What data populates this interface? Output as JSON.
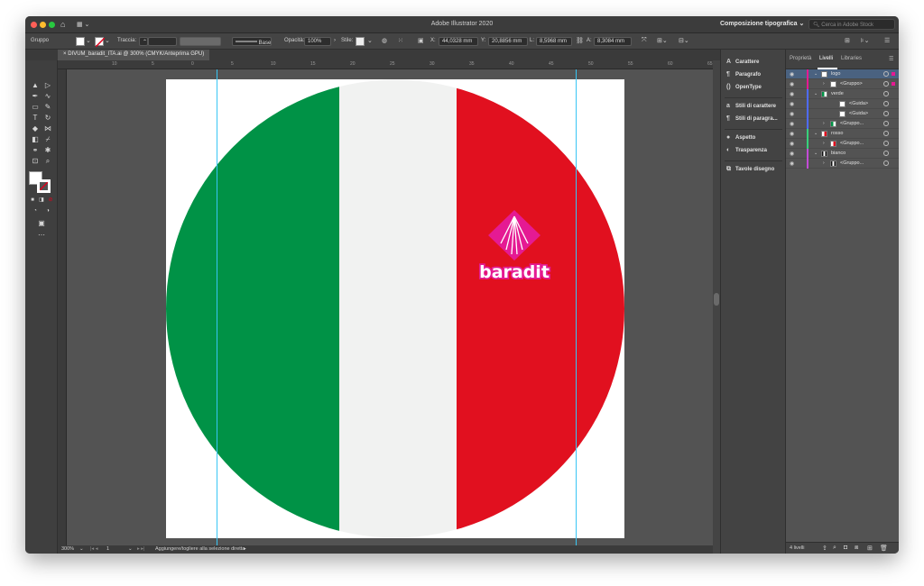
{
  "app": {
    "title": "Adobe Illustrator 2020",
    "workspace": "Composizione tipografica",
    "stock_search_placeholder": "Cerca in Adobe Stock"
  },
  "control_bar": {
    "selection_label": "Gruppo",
    "stroke_label": "Traccia:",
    "stroke_profile": "Base",
    "opacity_label": "Opacità:",
    "opacity_value": "100%",
    "style_label": "Stile:",
    "x_label": "X:",
    "x_value": "44,0328 mm",
    "y_label": "Y:",
    "y_value": "20,8856 mm",
    "w_label": "L:",
    "w_value": "8,5968 mm",
    "h_label": "A:",
    "h_value": "8,3084 mm"
  },
  "document_tab": {
    "title": "DIVUM_baradit_ITA.ai @ 300% (CMYK/Anteprima GPU)",
    "close": "×"
  },
  "rulers": {
    "top_ticks": [
      "10",
      "5",
      "0",
      "5",
      "10",
      "15",
      "20",
      "25",
      "30",
      "35",
      "40",
      "45",
      "50",
      "55",
      "60",
      "65"
    ]
  },
  "artwork": {
    "flag_colors": {
      "green": "#009246",
      "white": "#f1f2f1",
      "red": "#e1101f"
    },
    "logo_text": "baradit",
    "logo_color": "#e51a93"
  },
  "status_bar": {
    "zoom": "300%",
    "artboard_number": "1",
    "hint": "Aggiungere/togliere alla selezione diretta"
  },
  "mid_panel": {
    "items": [
      "Carattere",
      "Paragrafo",
      "OpenType",
      "Stili di carattere",
      "Stili di paragra...",
      "Aspetto",
      "Trasparenza",
      "Tavole disegno"
    ]
  },
  "layers_panel": {
    "tabs": [
      "Proprietà",
      "Livelli",
      "Libraries"
    ],
    "rows": [
      {
        "name": "logo",
        "indent": 0,
        "twisty": "v",
        "color": "#e51a93",
        "thumb": "white"
      },
      {
        "name": "<Gruppo>",
        "indent": 1,
        "twisty": ">",
        "color": "#e51a93",
        "thumb": "white"
      },
      {
        "name": "verde",
        "indent": 0,
        "twisty": "v",
        "color": "#4f6bff",
        "thumb": "green"
      },
      {
        "name": "<Guida>",
        "indent": 2,
        "twisty": "",
        "color": "#4f6bff",
        "thumb": "white"
      },
      {
        "name": "<Guida>",
        "indent": 2,
        "twisty": "",
        "color": "#4f6bff",
        "thumb": "white"
      },
      {
        "name": "<Gruppo...",
        "indent": 1,
        "twisty": ">",
        "color": "#4f6bff",
        "thumb": "green"
      },
      {
        "name": "rosso",
        "indent": 0,
        "twisty": "v",
        "color": "#36d27a",
        "thumb": "red"
      },
      {
        "name": "<Gruppo...",
        "indent": 1,
        "twisty": ">",
        "color": "#36d27a",
        "thumb": "red"
      },
      {
        "name": "bianco",
        "indent": 0,
        "twisty": "v",
        "color": "#c34bd6",
        "thumb": "dark"
      },
      {
        "name": "<Gruppo...",
        "indent": 1,
        "twisty": ">",
        "color": "#c34bd6",
        "thumb": "dark"
      }
    ],
    "footer_count": "4 livelli"
  }
}
